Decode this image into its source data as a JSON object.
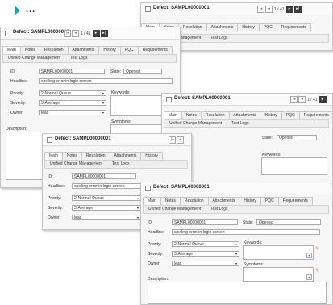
{
  "window": {
    "title": "Defect: SAMPL00000001",
    "page_counter": "1 / 41",
    "nav": {
      "first": "|◂",
      "prev": "◂",
      "next": "▸",
      "last": "▸|"
    }
  },
  "tabs": [
    "Main",
    "Notes",
    "Resolution",
    "Attachments",
    "History",
    "PQC",
    "Requirements"
  ],
  "subtabs": [
    "Unified Change Management",
    "Test Logs"
  ],
  "form": {
    "id_label": "ID:",
    "id_value": "SAMPL00000001",
    "state_label": "State:",
    "state_value": "Opened",
    "headline_label": "Headline:",
    "headline_value": "spelling error in login screen",
    "priority_label": "Priority:",
    "priority_value": "2-Normal Queue",
    "severity_label": "Severity:",
    "severity_value": "3-Average",
    "owner_label": "Owner:",
    "owner_value": "lead",
    "keywords_label": "Keywords:",
    "symptoms_label": "Symptoms:",
    "description_label": "Description:"
  },
  "fragments": {
    "headline_tail": "ror in login screen",
    "win3_headline_tail": "g error in login screen",
    "opened": "Opened",
    "opened_short": "Opened",
    "state_w4": "State:",
    "opened_w4": "Opened",
    "keywords_w4": "Keywords:",
    "keywords_short": "Keywo",
    "tab_frag_a": "ent",
    "tab_frag_b": "Test Logs",
    "page_frag": "1 / 41",
    "sub_frag_a": "Management",
    "sub_frag_b": "Test Logs",
    "win1_id_frag": "00001",
    "history_frag": "History",
    "pqc_frag": "PQC",
    "req_frag": "Requirements",
    "glyph_down": "▾",
    "glyph_pencil": "✎",
    "glyph_up": "▴",
    "dots": "...",
    "w3_sev": "e",
    "w3_id": "00001"
  },
  "colors": {
    "accent": "#17a7a7",
    "window_bg": "#f6f6f6",
    "field_border": "#a9a9a9"
  }
}
